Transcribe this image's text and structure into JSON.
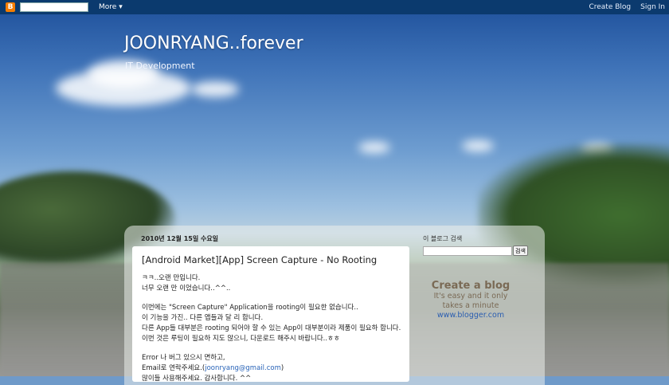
{
  "navbar": {
    "logo": "B",
    "search_placeholder": "",
    "more_label": "More",
    "create_blog_label": "Create Blog",
    "sign_in_label": "Sign In"
  },
  "header": {
    "title": "JOONRYANG..forever",
    "description": "IT Development"
  },
  "post": {
    "date": "2010년 12월 15일 수요일",
    "title": "[Android Market][App] Screen Capture - No Rooting",
    "lines": [
      "ㅋㅋ..오랜 만입니다.",
      "너무 오랜 만 이었습니다..^^..",
      "",
      "이번에는 \"Screen Capture\" Application을 rooting이 필요한 없습니다..",
      "이 기능을 가진.. 다른 앱들과 달 리 합니다.",
      "다른 App들 대부분은 rooting 되어야 할 수 있는 App이 대부분이라 제품이 필요하 합니다.",
      "이번 것은 루팅이 필요하 지도 않으니, 다운로드 해주시 바랍니다..ㅎㅎ",
      "",
      "Error 나 버그 있으시 면하고,"
    ],
    "email_prefix": "Email로 연락주세요.(",
    "email": "joonryang@gmail.com",
    "email_suffix": ")",
    "last_line": "많이들 사용해주세요. 감사합니다. ^^"
  },
  "sidebar": {
    "search_title": "이 블로그 검색",
    "search_button": "검색",
    "create_blog_heading": "Create a blog",
    "create_blog_line1": "It's easy and it only",
    "create_blog_line2": "takes a minute",
    "create_blog_link": "www.blogger.com"
  },
  "colors": {
    "navbar": "#0b3a6e",
    "blogger_orange": "#f57d00",
    "link": "#2863b8"
  }
}
